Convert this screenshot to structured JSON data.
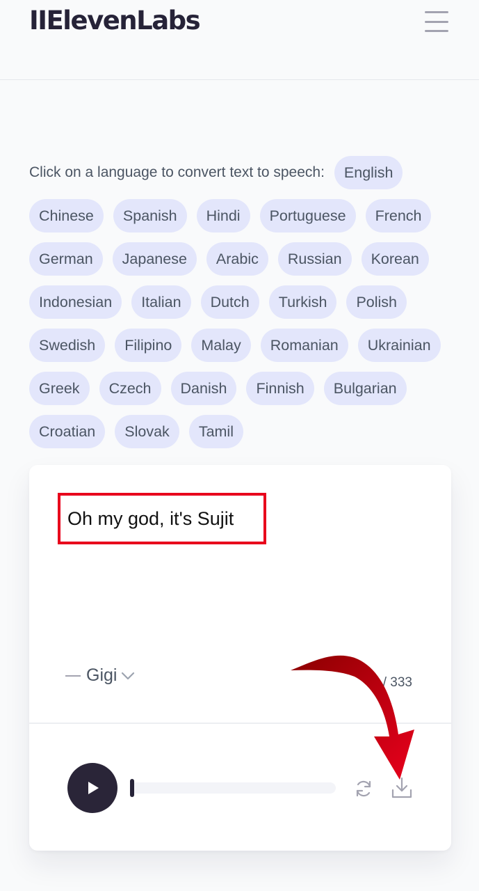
{
  "header": {
    "logo_text": "IIElevenLabs",
    "menu_icon": "hamburger-menu-icon"
  },
  "languages": {
    "prompt": "Click on a language to convert text to speech:",
    "items": [
      "English",
      "Chinese",
      "Spanish",
      "Hindi",
      "Portuguese",
      "French",
      "German",
      "Japanese",
      "Arabic",
      "Russian",
      "Korean",
      "Indonesian",
      "Italian",
      "Dutch",
      "Turkish",
      "Polish",
      "Swedish",
      "Filipino",
      "Malay",
      "Romanian",
      "Ukrainian",
      "Greek",
      "Czech",
      "Danish",
      "Finnish",
      "Bulgarian",
      "Croatian",
      "Slovak",
      "Tamil"
    ]
  },
  "card": {
    "text_value": "Oh my god, it's Sujit",
    "voice_name": "Gigi",
    "char_counter": "? / 333",
    "progress": 0.0
  },
  "colors": {
    "chip_bg": "#e3e6fb",
    "logo": "#262338",
    "play_button": "#2a2538",
    "annotation_red": "#e8001c"
  }
}
